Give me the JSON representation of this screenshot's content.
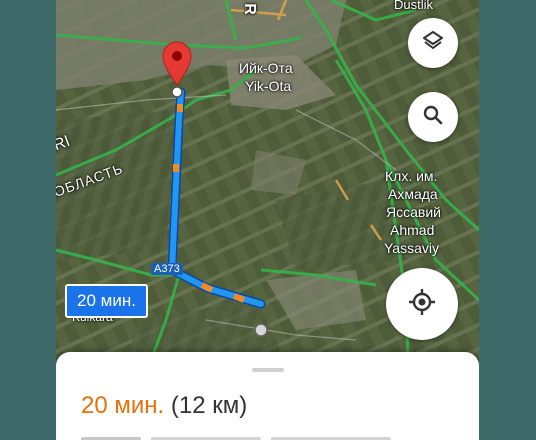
{
  "map": {
    "labels": {
      "dustlik": "Dustlik",
      "r_fragment": "R",
      "ri_fragment": "RI",
      "yik_ota_cyr": "Ийк-Ота",
      "yik_ota_lat": "Yik-Ota",
      "oblast": "ОБЛАСТЬ",
      "kolkhoz_1": "Клх. им.",
      "kolkhoz_2": "Ахмада",
      "kolkhoz_3": "Яссавий",
      "kolkhoz_4": "Ahmad",
      "kolkhoz_5": "Yassaviy",
      "road_number": "A373",
      "kulkara": "Kulkara"
    },
    "route_eta_badge": "20 мин.",
    "route_color": "#2196f3",
    "traffic_color": "#f28b23",
    "pin_color": "#e53935"
  },
  "controls": {
    "layers_icon": "layers-icon",
    "search_icon": "search-icon",
    "locate_icon": "my-location-icon"
  },
  "sheet": {
    "duration": "20 мин.",
    "distance": "(12 км)"
  }
}
